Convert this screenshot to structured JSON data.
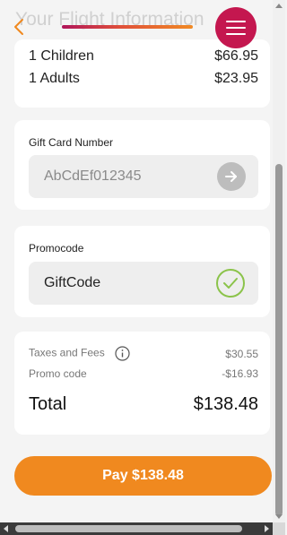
{
  "header": {
    "title": "Your Flight Information",
    "accent_gradient": [
      "#b0155a",
      "#e0503a",
      "#f08a24"
    ],
    "back_icon": "chevron-left-icon",
    "menu_icon": "hamburger-menu-icon"
  },
  "passengers": [
    {
      "label": "1 Children",
      "price": "$66.95"
    },
    {
      "label": "1 Adults",
      "price": "$23.95"
    }
  ],
  "gift_card": {
    "label": "Gift Card Number",
    "value": "AbCdEf012345",
    "submit_icon": "arrow-right-icon"
  },
  "promo": {
    "label": "Promocode",
    "value": "GiftCode",
    "status_icon": "check-circle-icon",
    "status_color": "#8bc34a"
  },
  "summary": {
    "taxes_label": "Taxes and Fees",
    "taxes_value": "$30.55",
    "promo_label": "Promo code",
    "promo_value": "-$16.93",
    "total_label": "Total",
    "total_value": "$138.48"
  },
  "pay_button": {
    "label": "Pay $138.48",
    "color": "#f0891f"
  }
}
